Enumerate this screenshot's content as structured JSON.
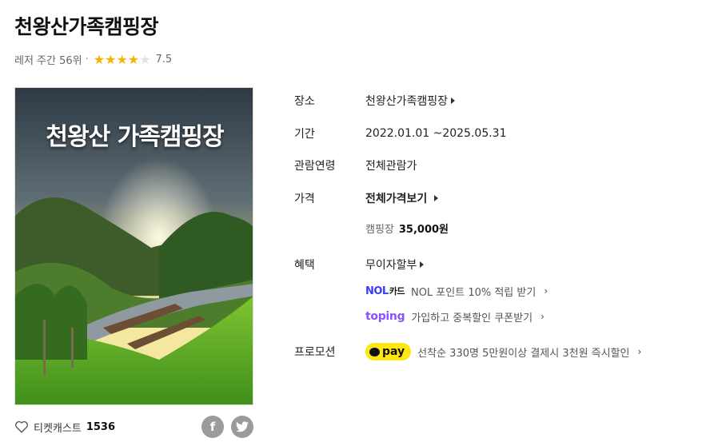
{
  "title": "천왕산가족캠핑장",
  "ranking": {
    "text": "레저 주간 56위",
    "stars_filled": 4,
    "stars_total": 5,
    "score": "7.5"
  },
  "poster": {
    "headline": "천왕산 가족캠핑장"
  },
  "ticketcast": {
    "label": "티켓캐스트",
    "count": "1536"
  },
  "share": {
    "facebook": "f",
    "twitter": "t"
  },
  "info": {
    "venue": {
      "label": "장소",
      "value": "천왕산가족캠핑장"
    },
    "period": {
      "label": "기간",
      "value": "2022.01.01 ~2025.05.31"
    },
    "age": {
      "label": "관람연령",
      "value": "전체관람가"
    },
    "price": {
      "label": "가격",
      "value": "전체가격보기",
      "item_label": "캠핑장",
      "item_price": "35,000원"
    },
    "benefit": {
      "label": "혜택",
      "value": "무이자할부",
      "nol_logo": "NOL",
      "nol_logo_suffix": "카드",
      "nol_text": "NOL 포인트 10% 적립 받기",
      "toping_logo": "toping",
      "toping_text": "가입하고 중복할인 쿠폰받기"
    },
    "promotion": {
      "label": "프로모션",
      "pay_logo": "pay",
      "text": "선착순 330명 5만원이상 결제시 3천원 즉시할인"
    }
  },
  "colors": {
    "star": "#f5b400",
    "nol": "#3b3bff",
    "toping": "#8a52ff",
    "kakaopay": "#ffe812"
  }
}
